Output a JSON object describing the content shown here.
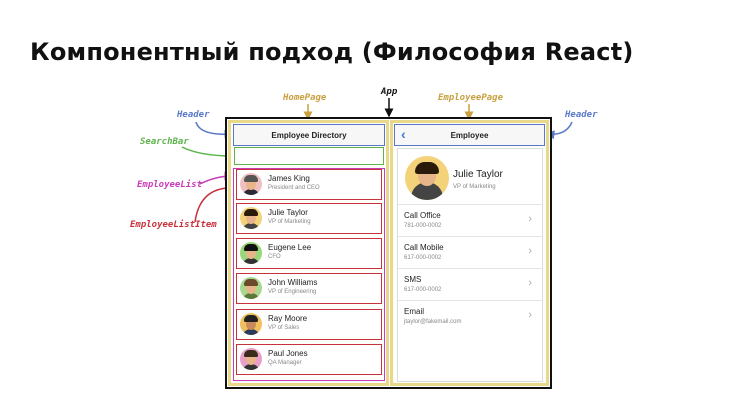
{
  "slide": {
    "title": "Компонентный подход (Философия React)"
  },
  "tags": {
    "header_left": "Header",
    "homepage": "HomePage",
    "app": "App",
    "employeepage": "EmployeePage",
    "header_right": "Header",
    "searchbar": "SearchBar",
    "employeelist": "EmployeeList",
    "employeelistitem": "EmployeeListItem"
  },
  "home": {
    "header": "Employee Directory",
    "employees": [
      {
        "name": "James King",
        "title": "President and CEO"
      },
      {
        "name": "Julie Taylor",
        "title": "VP of Marketing"
      },
      {
        "name": "Eugene Lee",
        "title": "CFO"
      },
      {
        "name": "John Williams",
        "title": "VP of Engineering"
      },
      {
        "name": "Ray Moore",
        "title": "VP of Sales"
      },
      {
        "name": "Paul Jones",
        "title": "QA Manager"
      }
    ]
  },
  "employee": {
    "header": "Employee",
    "back_icon": "chevron-left-icon",
    "name": "Julie Taylor",
    "title": "VP of Marketing",
    "actions": [
      {
        "label": "Call Office",
        "value": "781-000-0002"
      },
      {
        "label": "Call Mobile",
        "value": "617-000-0002"
      },
      {
        "label": "SMS",
        "value": "617-000-0002"
      },
      {
        "label": "Email",
        "value": "jtaylor@fakemail.com"
      }
    ]
  },
  "colors": {
    "header": "#5a78c8",
    "homepage": "#c8a040",
    "app": "#111111",
    "searchbar": "#5cb34a",
    "employeelist": "#c83cb8",
    "employeelistitem": "#c8323c"
  }
}
